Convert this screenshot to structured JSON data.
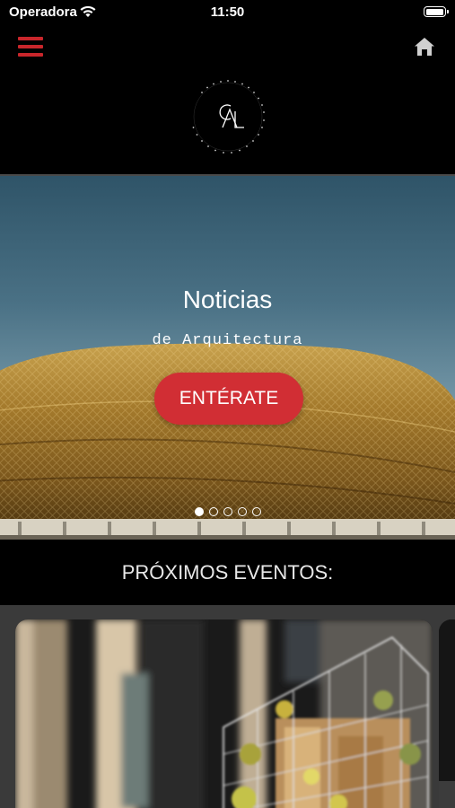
{
  "status_bar": {
    "carrier": "Operadora",
    "time": "11:50"
  },
  "header": {
    "menu_icon": "hamburger-menu-icon",
    "home_icon": "home-icon",
    "logo_name": "CAL logo"
  },
  "hero": {
    "title": "Noticias",
    "subtitle": "de Arquitectura",
    "button_label": "ENTÉRATE",
    "slide_count": 5,
    "active_slide": 1
  },
  "events": {
    "title": "PRÓXIMOS EVENTOS:"
  },
  "colors": {
    "accent": "#d12e34",
    "menu": "#c9262b",
    "background": "#000000"
  }
}
